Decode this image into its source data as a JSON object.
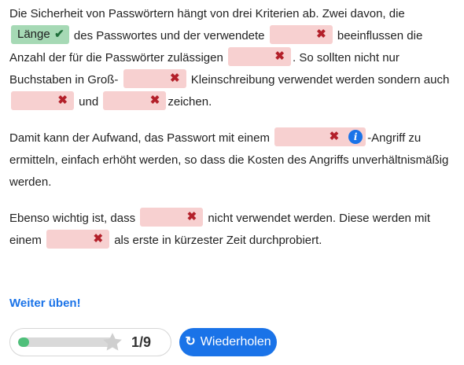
{
  "paragraphs": {
    "p1": {
      "t1": "Die Sicherheit von Passwörtern hängt von drei Kriterien ab. Zwei davon, die",
      "correct_word": "Länge",
      "t2": "des Passwortes und der verwendete",
      "t3": "beeinflussen die Anzahl der für die Passwörter zulässigen",
      "t4": ". So sollten nicht nur Buchstaben in Groß-",
      "t5": "Kleinschreibung verwendet werden sondern auch",
      "t6": "und",
      "t7": "zeichen."
    },
    "p2": {
      "t1": "Damit kann der Aufwand, das Passwort mit einem",
      "t2": "-Angriff zu ermitteln, einfach erhöht werden, so dass die Kosten des Angriffs unverhältnismäßig werden."
    },
    "p3": {
      "t1": "Ebenso wichtig ist, dass",
      "t2": "nicht verwendet werden. Diese werden mit einem",
      "t3": "als erste in kürzester Zeit durchprobiert."
    }
  },
  "icons": {
    "wrong": "✖",
    "correct": "✔",
    "info": "i",
    "retry": "↻"
  },
  "footer": {
    "more_practice": "Weiter üben!",
    "score": "1/9",
    "progress_fraction": 0.111,
    "retry_label": "Wiederholen"
  },
  "colors": {
    "wrong_bg": "#f7d0d0",
    "correct_bg": "#a6d9b5",
    "accent": "#1a73e8"
  }
}
